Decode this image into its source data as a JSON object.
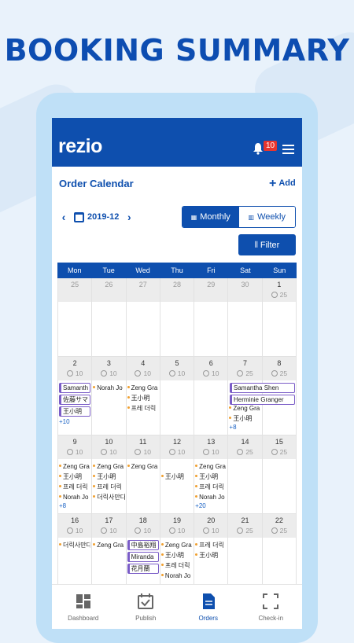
{
  "headline": "BOOKING SUMMARY",
  "app": {
    "logo": "rezio",
    "notification_count": "10"
  },
  "page": {
    "title": "Order Calendar",
    "add_label": "Add",
    "month": "2019-12",
    "view_monthly": "Monthly",
    "view_weekly": "Weekly",
    "filter_label": "Filter"
  },
  "calendar": {
    "days_of_week": [
      "Mon",
      "Tue",
      "Wed",
      "Thu",
      "Fri",
      "Sat",
      "Sun"
    ],
    "weeks": [
      {
        "days": [
          {
            "num": "25",
            "muted": true,
            "cap": "",
            "events": [],
            "more": ""
          },
          {
            "num": "26",
            "muted": true,
            "cap": "",
            "events": [],
            "more": ""
          },
          {
            "num": "27",
            "muted": true,
            "cap": "",
            "events": [],
            "more": ""
          },
          {
            "num": "28",
            "muted": true,
            "cap": "",
            "events": [],
            "more": ""
          },
          {
            "num": "29",
            "muted": true,
            "cap": "",
            "events": [],
            "more": ""
          },
          {
            "num": "30",
            "muted": true,
            "cap": "",
            "events": [],
            "more": ""
          },
          {
            "num": "1",
            "muted": false,
            "cap": "25",
            "events": [],
            "more": ""
          }
        ],
        "spans": []
      },
      {
        "days": [
          {
            "num": "2",
            "cap": "10",
            "events": [
              {
                "t": "Samanth",
                "box": true
              },
              {
                "t": "佐藤サマ",
                "box": true
              },
              {
                "t": "王小明",
                "box": true
              }
            ],
            "more": "+10"
          },
          {
            "num": "3",
            "cap": "10",
            "events": [
              {
                "t": "Norah Jo",
                "box": false
              }
            ],
            "more": ""
          },
          {
            "num": "4",
            "cap": "10",
            "events": [
              {
                "t": "Zeng Gra",
                "box": false
              },
              {
                "t": "王小明",
                "box": false
              },
              {
                "t": "프레 더릭",
                "box": false
              }
            ],
            "more": ""
          },
          {
            "num": "5",
            "cap": "10",
            "events": [],
            "more": ""
          },
          {
            "num": "6",
            "cap": "10",
            "events": [],
            "more": ""
          },
          {
            "num": "7",
            "cap": "25",
            "events": [
              {
                "t": "",
                "box": false
              },
              {
                "t": "",
                "box": false
              },
              {
                "t": "Zeng Gra",
                "box": false
              },
              {
                "t": "王小明",
                "box": false
              }
            ],
            "more": "+8"
          },
          {
            "num": "8",
            "cap": "25",
            "events": [],
            "more": ""
          }
        ],
        "spans": [
          "Samantha Shen",
          "Herminie Granger"
        ]
      },
      {
        "days": [
          {
            "num": "9",
            "cap": "10",
            "events": [
              {
                "t": "Zeng Gra",
                "box": false
              },
              {
                "t": "王小明",
                "box": false
              },
              {
                "t": "프레 더릭",
                "box": false
              },
              {
                "t": "Norah Jo",
                "box": false
              }
            ],
            "more": "+8"
          },
          {
            "num": "10",
            "cap": "10",
            "events": [
              {
                "t": "Zeng Gra",
                "box": false
              },
              {
                "t": "王小明",
                "box": false
              },
              {
                "t": "프레 더릭",
                "box": false
              },
              {
                "t": "더릭사만다",
                "box": false
              }
            ],
            "more": ""
          },
          {
            "num": "11",
            "cap": "10",
            "events": [
              {
                "t": "Zeng Gra",
                "box": false
              }
            ],
            "more": ""
          },
          {
            "num": "12",
            "cap": "10",
            "events": [
              {
                "t": "",
                "box": false
              },
              {
                "t": "王小明",
                "box": false
              }
            ],
            "more": ""
          },
          {
            "num": "13",
            "cap": "10",
            "events": [
              {
                "t": "Zeng Gra",
                "box": false
              },
              {
                "t": "王小明",
                "box": false
              },
              {
                "t": "프레 더릭",
                "box": false
              },
              {
                "t": "Norah Jo",
                "box": false
              }
            ],
            "more": "+20"
          },
          {
            "num": "14",
            "cap": "25",
            "events": [],
            "more": ""
          },
          {
            "num": "15",
            "cap": "25",
            "events": [],
            "more": ""
          }
        ],
        "spans": []
      },
      {
        "days": [
          {
            "num": "16",
            "cap": "10",
            "events": [
              {
                "t": "더릭사만다",
                "box": false
              }
            ],
            "more": ""
          },
          {
            "num": "17",
            "cap": "10",
            "events": [
              {
                "t": "Zeng Gra",
                "box": false
              }
            ],
            "more": ""
          },
          {
            "num": "18",
            "cap": "10",
            "events": [
              {
                "t": "中島裕翔",
                "box": true
              },
              {
                "t": "Miranda",
                "box": true
              },
              {
                "t": "花月蘭",
                "box": true
              }
            ],
            "more": ""
          },
          {
            "num": "19",
            "cap": "10",
            "events": [
              {
                "t": "Zeng Gra",
                "box": false
              },
              {
                "t": "王小明",
                "box": false
              },
              {
                "t": "프레 더릭",
                "box": false
              },
              {
                "t": "Norah Jo",
                "box": false
              }
            ],
            "more": ""
          },
          {
            "num": "20",
            "cap": "10",
            "events": [
              {
                "t": "프레 더릭",
                "box": false
              },
              {
                "t": "王小明",
                "box": false
              }
            ],
            "more": ""
          },
          {
            "num": "21",
            "cap": "25",
            "events": [],
            "more": ""
          },
          {
            "num": "22",
            "cap": "25",
            "events": [],
            "more": ""
          }
        ],
        "spans": []
      }
    ]
  },
  "tabs": [
    {
      "label": "Dashboard",
      "icon": "dashboard-icon",
      "active": false
    },
    {
      "label": "Publish",
      "icon": "calendar-check-icon",
      "active": false
    },
    {
      "label": "Orders",
      "icon": "document-icon",
      "active": true
    },
    {
      "label": "Check-in",
      "icon": "scan-icon",
      "active": false
    }
  ],
  "colors": {
    "brand": "#0e4fae",
    "accent_dot": "#f0a030",
    "booking_border": "#7a5cc7",
    "badge": "#e8352e"
  }
}
